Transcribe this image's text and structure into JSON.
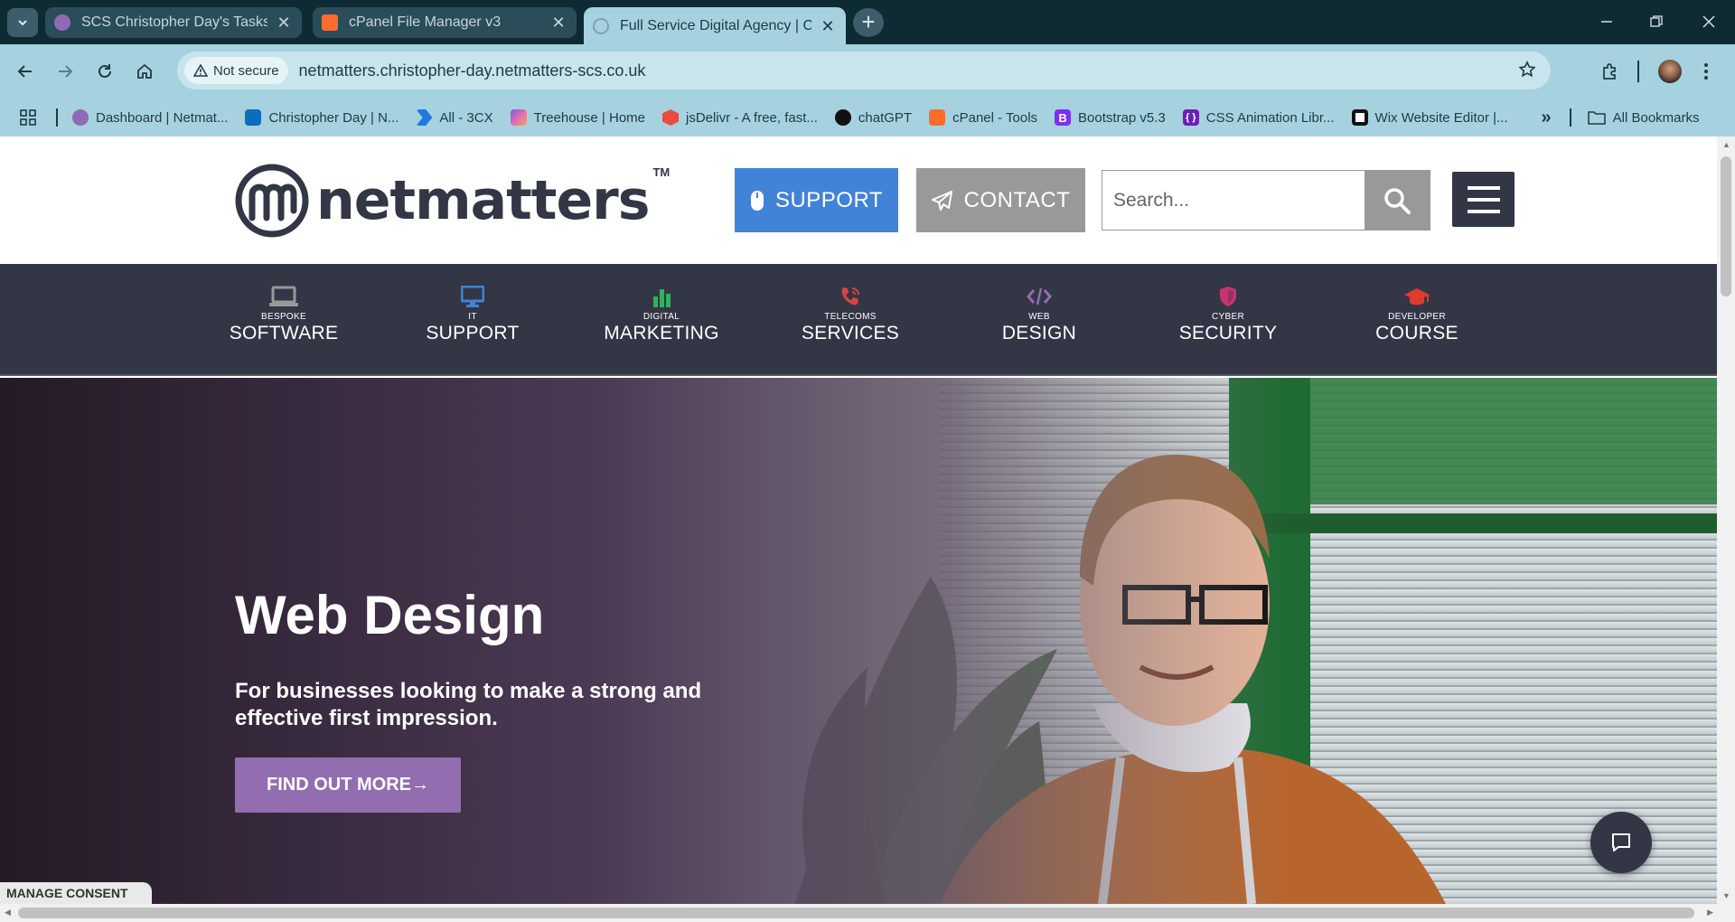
{
  "browser": {
    "tabs": [
      {
        "title": "SCS Christopher Day's Tasks",
        "favicon_color": "#8e6bb3",
        "active": false
      },
      {
        "title": "cPanel File Manager v3",
        "favicon_color": "#ff6c2c",
        "active": false
      },
      {
        "title": "Full Service Digital Agency | Car",
        "favicon_color": "#9fb8c0",
        "active": true
      }
    ],
    "security_label": "Not secure",
    "url": "netmatters.christopher-day.netmatters-scs.co.uk",
    "bookmarks": [
      {
        "label": "Dashboard | Netmat...",
        "color": "#8e6bb3"
      },
      {
        "label": "Christopher Day | N...",
        "color": "#0f6cbd"
      },
      {
        "label": "All - 3CX",
        "color": "#1f7ae0"
      },
      {
        "label": "Treehouse | Home",
        "color": "#7d5bd6"
      },
      {
        "label": "jsDelivr - A free, fast...",
        "color": "#e84d3d"
      },
      {
        "label": "chatGPT",
        "color": "#111111"
      },
      {
        "label": "cPanel - Tools",
        "color": "#ff6c2c"
      },
      {
        "label": "Bootstrap v5.3",
        "color": "#7b2ff7"
      },
      {
        "label": "CSS Animation Libr...",
        "color": "#6a1fb8"
      },
      {
        "label": "Wix Website Editor |...",
        "color": "#111111"
      }
    ],
    "all_bookmarks_label": "All Bookmarks"
  },
  "header": {
    "logo_text": "netmatters",
    "trademark": "TM",
    "support_label": "SUPPORT",
    "contact_label": "CONTACT",
    "search_placeholder": "Search..."
  },
  "services": [
    {
      "small": "BESPOKE",
      "big": "SOFTWARE",
      "icon": "laptop-icon",
      "color": "#999999"
    },
    {
      "small": "IT",
      "big": "SUPPORT",
      "icon": "desktop-icon",
      "color": "#4183d7"
    },
    {
      "small": "DIGITAL",
      "big": "MARKETING",
      "icon": "bar-chart-icon",
      "color": "#2fb45a"
    },
    {
      "small": "TELECOMS",
      "big": "SERVICES",
      "icon": "phone-icon",
      "color": "#d64541"
    },
    {
      "small": "WEB",
      "big": "DESIGN",
      "icon": "code-icon",
      "color": "#926daf"
    },
    {
      "small": "CYBER",
      "big": "SECURITY",
      "icon": "shield-icon",
      "color": "#c93370"
    },
    {
      "small": "DEVELOPER",
      "big": "COURSE",
      "icon": "graduation-cap-icon",
      "color": "#df3b2f"
    }
  ],
  "hero": {
    "title": "Web Design",
    "subtitle": "For businesses looking to make a strong and effective first impression.",
    "cta": "FIND OUT MORE",
    "cta_arrow": "→"
  },
  "consent_label": "MANAGE CONSENT",
  "colors": {
    "brand_dark": "#333645",
    "support_blue": "#4183d7",
    "web_design_purple": "#926daf",
    "browser_accent": "#a6d2df"
  }
}
